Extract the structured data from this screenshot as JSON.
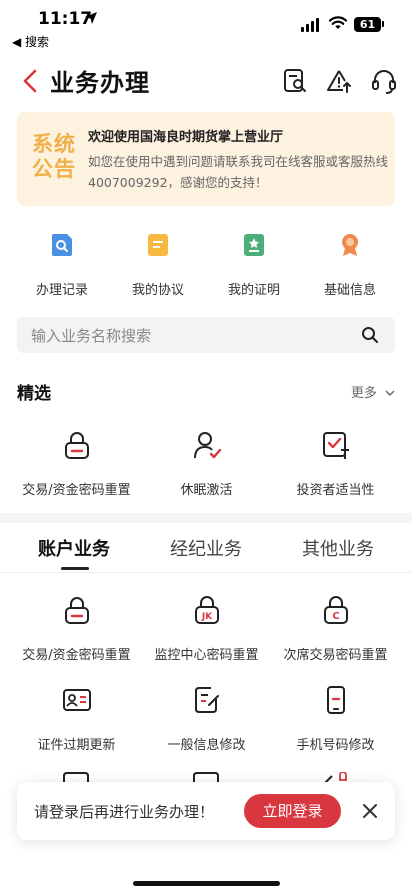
{
  "status": {
    "time": "11:17",
    "back_app": "◀ 搜索",
    "battery": "61"
  },
  "header": {
    "title": "业务办理",
    "icons": [
      "search-document-icon",
      "alert-icon",
      "headset-icon"
    ]
  },
  "notice": {
    "logo_line1": "系统",
    "logo_line2": "公告",
    "title": "欢迎使用国海良时期货掌上营业厅",
    "body": "如您在使用中遇到问题请联系我司在线客服或客服热线4007009292，感谢您的支持！"
  },
  "quick": [
    {
      "label": "办理记录",
      "icon": "record-search-icon",
      "color": "#4a90e2"
    },
    {
      "label": "我的协议",
      "icon": "agreement-icon",
      "color": "#f5b942"
    },
    {
      "label": "我的证明",
      "icon": "certificate-icon",
      "color": "#4caf7a"
    },
    {
      "label": "基础信息",
      "icon": "medal-icon",
      "color": "#f08a4b"
    }
  ],
  "search": {
    "placeholder": "输入业务名称搜索"
  },
  "featured": {
    "title": "精选",
    "more": "更多",
    "items": [
      {
        "label": "交易/资金密码重置",
        "icon": "lock-reset-icon"
      },
      {
        "label": "休眠激活",
        "icon": "user-check-icon"
      },
      {
        "label": "投资者适当性",
        "icon": "checklist-icon"
      }
    ]
  },
  "tabs": {
    "items": [
      "账户业务",
      "经纪业务",
      "其他业务"
    ],
    "active_index": 0
  },
  "account_services": [
    {
      "label": "交易/资金密码重置",
      "icon": "lock-reset-icon",
      "badge": ""
    },
    {
      "label": "监控中心密码重置",
      "icon": "lock-jk-icon",
      "badge": "JK"
    },
    {
      "label": "次席交易密码重置",
      "icon": "lock-c-icon",
      "badge": "C"
    },
    {
      "label": "证件过期更新",
      "icon": "id-card-icon",
      "badge": ""
    },
    {
      "label": "一般信息修改",
      "icon": "edit-form-icon",
      "badge": ""
    },
    {
      "label": "手机号码修改",
      "icon": "mobile-phone-icon",
      "badge": ""
    }
  ],
  "toast": {
    "text": "请登录后再进行业务办理！",
    "button": "立即登录"
  },
  "colors": {
    "accent": "#d9373f",
    "notice_bg": "#fdf1e0",
    "notice_logo": "#f0b048"
  }
}
